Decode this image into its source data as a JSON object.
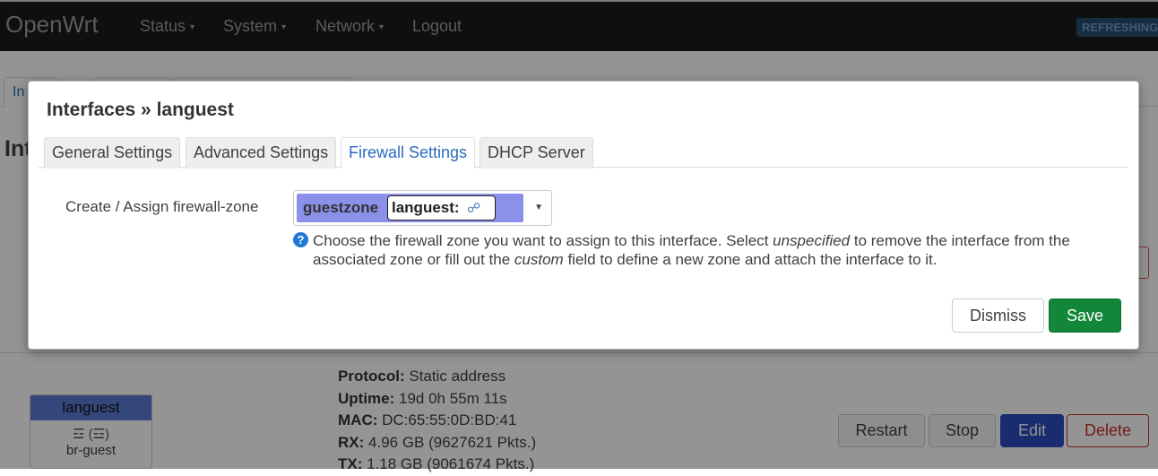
{
  "navbar": {
    "brand": "OpenWrt",
    "items": [
      "Status",
      "System",
      "Network",
      "Logout"
    ],
    "status_badge": "REFRESHING"
  },
  "background": {
    "tab_partial": "In",
    "heading_partial": "Int",
    "interface": {
      "name": "languest",
      "device_icons": "☲ (☲)",
      "device": "br-guest"
    },
    "status": [
      {
        "key": "Protocol:",
        "value": "Static address"
      },
      {
        "key": "Uptime:",
        "value": "19d 0h 55m 11s"
      },
      {
        "key": "MAC:",
        "value": "DC:65:55:0D:BD:41"
      },
      {
        "key": "RX:",
        "value": "4.96 GB (9627621 Pkts.)"
      },
      {
        "key": "TX:",
        "value": "1.18 GB (9061674 Pkts.)"
      }
    ],
    "actions": [
      "Restart",
      "Stop",
      "Edit",
      "Delete"
    ]
  },
  "modal": {
    "title": "Interfaces » languest",
    "tabs": [
      "General Settings",
      "Advanced Settings",
      "Firewall Settings",
      "DHCP Server"
    ],
    "active_tab": "Firewall Settings",
    "field_label": "Create / Assign firewall-zone",
    "selected_zone": "guestzone",
    "selected_network": "languest:",
    "help": {
      "part1": "Choose the firewall zone you want to assign to this interface. Select ",
      "em1": "unspecified",
      "part2": " to remove the interface from the associated zone or fill out the ",
      "em2": "custom",
      "part3": " field to define a new zone and attach the interface to it."
    },
    "buttons": {
      "dismiss": "Dismiss",
      "save": "Save"
    }
  },
  "colors": {
    "navbar_bg": "#1b1b1b",
    "zone_color": "#8b90e8",
    "link_blue": "#2a6cbf",
    "save_green": "#12873a",
    "delete_red": "#c9302c"
  }
}
